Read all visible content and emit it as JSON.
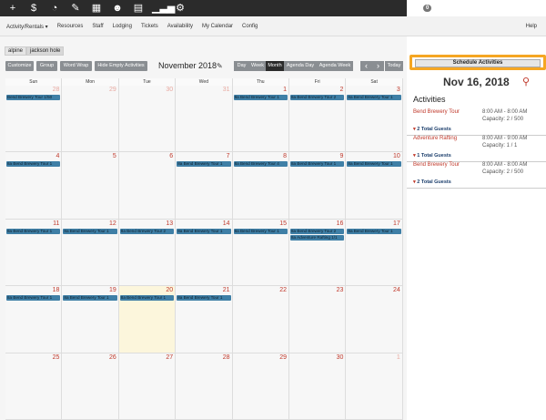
{
  "topbar": {
    "icons": [
      "plus-icon",
      "dollar-icon",
      "dashboard-icon",
      "wrench-icon",
      "calendar-icon",
      "users-icon",
      "document-icon",
      "chart-icon",
      "settings-icon"
    ],
    "chat_count": "0",
    "account_label": "THE FLYBOOK",
    "account_caret": "▾"
  },
  "nav": {
    "items": [
      "Activity/Rentals ▾",
      "Resources",
      "Staff",
      "Lodging",
      "Tickets",
      "Availability",
      "My Calendar",
      "Config"
    ],
    "help": "Help"
  },
  "locations": [
    "alpine",
    "jackson hole"
  ],
  "toolbar": {
    "customize": "Customize",
    "group": "Group",
    "word_wrap": "Word Wrap",
    "hide_empty": "Hide Empty Activities",
    "month_title": "November 2018",
    "views": [
      "Day",
      "Week",
      "Month",
      "Agenda Day",
      "Agenda Week"
    ],
    "active_view": "Month",
    "prev": "‹",
    "next": "›",
    "today": "Today"
  },
  "calendar": {
    "weekdays": [
      "Sun",
      "Mon",
      "Tue",
      "Wed",
      "Thu",
      "Fri",
      "Sat"
    ],
    "weeks": [
      [
        {
          "day": "28",
          "other": true,
          "events": [
            "Bend Brewery Tour 1/50"
          ]
        },
        {
          "day": "29",
          "other": true,
          "events": []
        },
        {
          "day": "30",
          "other": true,
          "events": []
        },
        {
          "day": "31",
          "other": true,
          "events": []
        },
        {
          "day": "1",
          "other": false,
          "events": [
            "8a Bend Brewery Tour 1"
          ]
        },
        {
          "day": "2",
          "other": false,
          "events": [
            "8a Bend Brewery Tour 2"
          ]
        },
        {
          "day": "3",
          "other": false,
          "events": [
            "8a Bend Brewery Tour 1"
          ]
        }
      ],
      [
        {
          "day": "4",
          "other": false,
          "events": [
            "8a Bend Brewery Tour 1"
          ]
        },
        {
          "day": "5",
          "other": false,
          "events": []
        },
        {
          "day": "6",
          "other": false,
          "events": []
        },
        {
          "day": "7",
          "other": false,
          "events": [
            "8a Bend Brewery Tour 1"
          ]
        },
        {
          "day": "8",
          "other": false,
          "events": [
            "8a Bend Brewery Tour 4"
          ]
        },
        {
          "day": "9",
          "other": false,
          "events": [
            "8a Bend Brewery Tour 1"
          ]
        },
        {
          "day": "10",
          "other": false,
          "events": [
            "8a Bend Brewery Tour 1"
          ]
        }
      ],
      [
        {
          "day": "11",
          "other": false,
          "events": [
            "8a Bend Brewery Tour 1"
          ]
        },
        {
          "day": "12",
          "other": false,
          "events": [
            "8a Bend Brewery Tour 1"
          ]
        },
        {
          "day": "13",
          "other": false,
          "events": [
            "8a Bend Brewery Tour 2"
          ]
        },
        {
          "day": "14",
          "other": false,
          "events": [
            "8a Bend Brewery Tour 1"
          ]
        },
        {
          "day": "15",
          "other": false,
          "events": [
            "8a Bend Brewery Tour 1"
          ]
        },
        {
          "day": "16",
          "other": false,
          "events": [
            "8a Bend Brewery Tour 2",
            "8a Adventure Rafting 1/1"
          ]
        },
        {
          "day": "17",
          "other": false,
          "events": [
            "8a Bend Brewery Tour 1"
          ]
        }
      ],
      [
        {
          "day": "18",
          "other": false,
          "events": [
            "8a Bend Brewery Tour 1"
          ]
        },
        {
          "day": "19",
          "other": false,
          "events": [
            "8a Bend Brewery Tour 1"
          ]
        },
        {
          "day": "20",
          "other": false,
          "today": true,
          "events": [
            "8a Bend Brewery Tour 1"
          ]
        },
        {
          "day": "21",
          "other": false,
          "events": [
            "8a Bend Brewery Tour 1"
          ]
        },
        {
          "day": "22",
          "other": false,
          "events": []
        },
        {
          "day": "23",
          "other": false,
          "events": []
        },
        {
          "day": "24",
          "other": false,
          "events": []
        }
      ],
      [
        {
          "day": "25",
          "other": false,
          "events": []
        },
        {
          "day": "26",
          "other": false,
          "events": []
        },
        {
          "day": "27",
          "other": false,
          "events": []
        },
        {
          "day": "28",
          "other": false,
          "events": []
        },
        {
          "day": "29",
          "other": false,
          "events": []
        },
        {
          "day": "30",
          "other": false,
          "events": []
        },
        {
          "day": "1",
          "other": true,
          "events": []
        }
      ]
    ]
  },
  "panel": {
    "schedule_button": "Schedule Activities",
    "selected_date": "Nov 16, 2018",
    "activities_heading": "Activities",
    "activities": [
      {
        "name": "Bend Brewery Tour",
        "time": "8:00 AM - 8:00 AM",
        "capacity": "Capacity: 2 / 500",
        "guests": "2 Total Guests"
      },
      {
        "name": "Adventure Rafting",
        "time": "8:00 AM - 9:00 AM",
        "capacity": "Capacity: 1 / 1",
        "guests": "1 Total Guests"
      },
      {
        "name": "Bend Brewery Tour",
        "time": "8:00 AM - 8:00 AM",
        "capacity": "Capacity: 2 / 500",
        "guests": "2 Total Guests"
      }
    ]
  },
  "colors": {
    "accent_red": "#c0392b",
    "event_blue": "#3f7fa6",
    "highlight_orange": "#f5a623",
    "today_bg": "#fcf6dc"
  }
}
